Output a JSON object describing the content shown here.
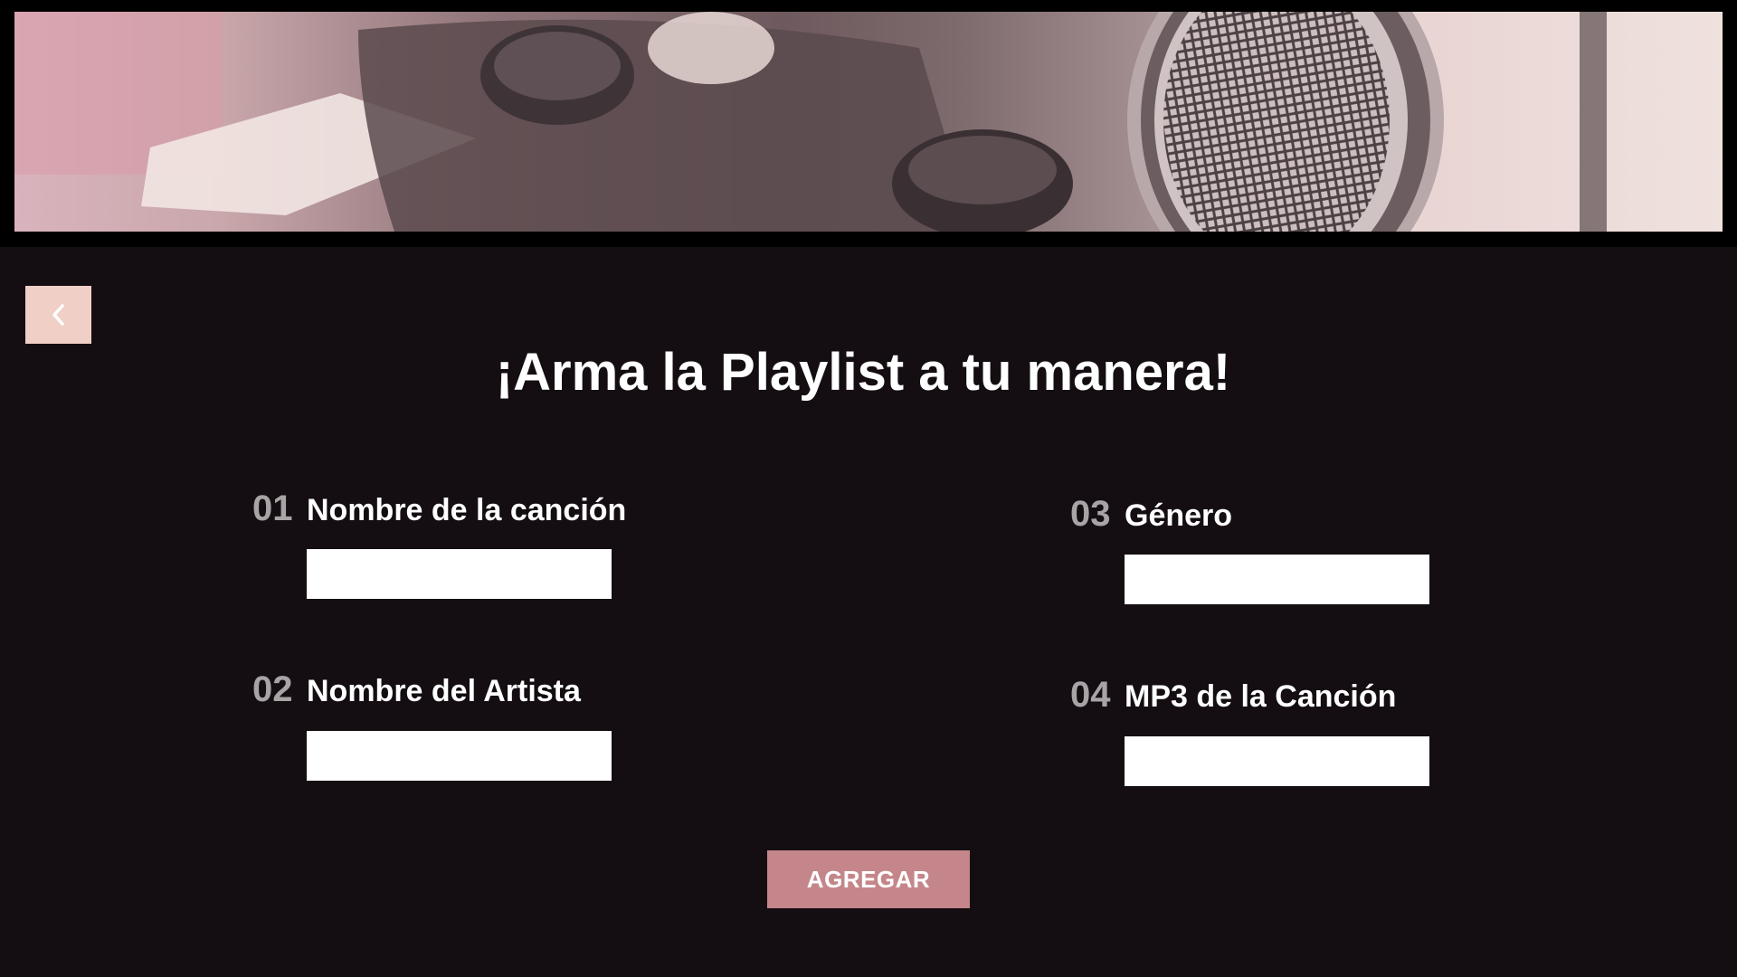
{
  "page": {
    "background_color": "#140e12",
    "title": "¡Arma la Playlist a tu manera!"
  },
  "hero": {
    "description": "",
    "icon": "microphone-photo"
  },
  "nav": {
    "back_icon": "chevron-left-icon",
    "back_button_color": "#efcfc6"
  },
  "form": {
    "fields": [
      {
        "number": "01",
        "label": "Nombre de la canción",
        "value": "",
        "placeholder": ""
      },
      {
        "number": "02",
        "label": "Nombre del Artista",
        "value": "",
        "placeholder": ""
      },
      {
        "number": "03",
        "label": "Género",
        "value": "",
        "placeholder": ""
      },
      {
        "number": "04",
        "label": "MP3 de la Canción",
        "value": "",
        "placeholder": ""
      }
    ],
    "submit_label": "AGREGAR",
    "submit_color": "#c4868a"
  }
}
